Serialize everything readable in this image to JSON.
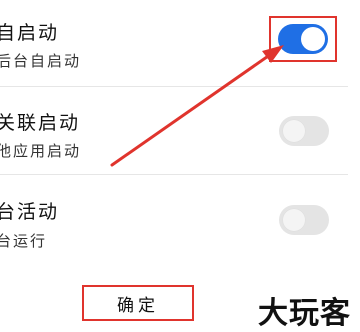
{
  "rows": [
    {
      "title": "自启动",
      "subtitle": "后台自启动",
      "toggle_on": true
    },
    {
      "title": "关联启动",
      "subtitle": "他应用启动",
      "toggle_on": false
    },
    {
      "title": "台活动",
      "subtitle": "台运行",
      "toggle_on": false
    }
  ],
  "confirm_label": "确定",
  "watermark": "大玩客",
  "colors": {
    "toggle_on": "#1f6fe5",
    "toggle_off": "#e4e4e4",
    "annotation": "#e0342d"
  }
}
